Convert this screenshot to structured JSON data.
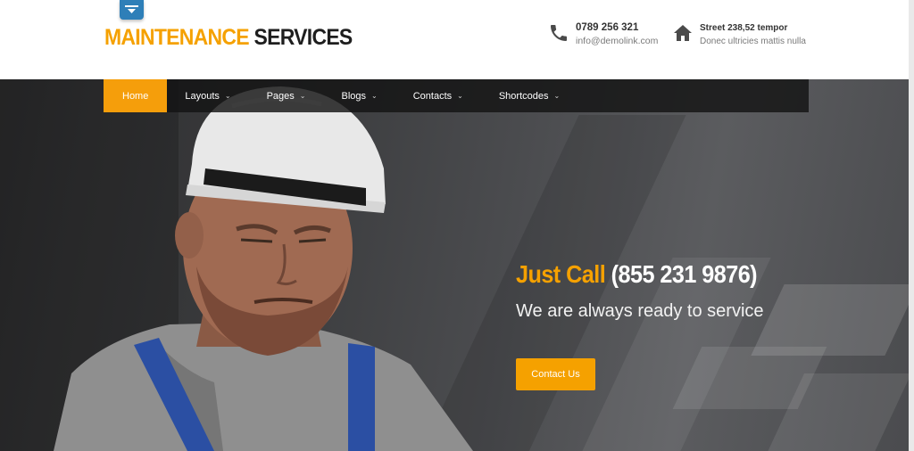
{
  "brand": {
    "logo_part1": "MAINTENANCE",
    "logo_part2": "SERVICES",
    "accent_color": "#f5a100",
    "badge_color": "#2e7fb8"
  },
  "contact": {
    "phone": "0789 256 321",
    "email": "info@demolink.com",
    "phone_icon": "phone-icon",
    "address_line1": "Street 238,52 tempor",
    "address_line2": "Donec ultricies mattis nulla",
    "address_icon": "home-icon"
  },
  "nav": {
    "items": [
      {
        "label": "Home",
        "active": true
      },
      {
        "label": "Layouts",
        "dropdown": true
      },
      {
        "label": "Pages",
        "dropdown": true
      },
      {
        "label": "Blogs",
        "dropdown": true
      },
      {
        "label": "Contacts",
        "dropdown": true
      },
      {
        "label": "Shortcodes",
        "dropdown": true
      }
    ],
    "dropdown_glyph": "⌄"
  },
  "hero": {
    "title_accent": "Just Call",
    "title_phone": "(855 231 9876)",
    "subtitle": "We are always ready to service",
    "cta_label": "Contact Us"
  }
}
